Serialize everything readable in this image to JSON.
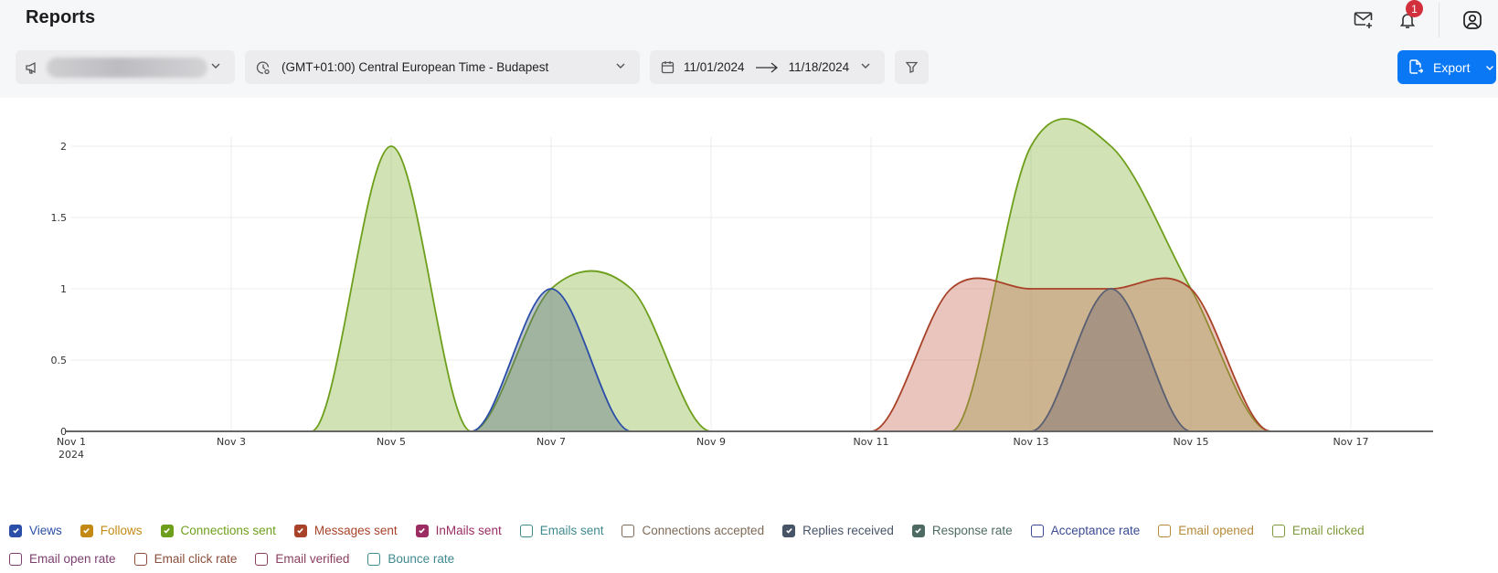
{
  "header": {
    "title": "Reports",
    "notifications_count": "1"
  },
  "filters": {
    "campaign_value": "",
    "timezone": "(GMT+01:00) Central European Time - Budapest",
    "date_from": "11/01/2024",
    "date_to": "11/18/2024"
  },
  "toolbar": {
    "export_label": "Export"
  },
  "colors": {
    "export": "#0a78f5",
    "badge": "#d2303d"
  },
  "legend": [
    {
      "label": "Views",
      "checked": true,
      "color": "#2b4ea8"
    },
    {
      "label": "Follows",
      "checked": true,
      "color": "#c28a14"
    },
    {
      "label": "Connections sent",
      "checked": true,
      "color": "#6e9f1c"
    },
    {
      "label": "Messages sent",
      "checked": true,
      "color": "#a8432a"
    },
    {
      "label": "InMails sent",
      "checked": true,
      "color": "#9b2d63"
    },
    {
      "label": "Emails sent",
      "checked": false,
      "color": "#3f8a8f"
    },
    {
      "label": "Connections accepted",
      "checked": false,
      "color": "#7d6a57"
    },
    {
      "label": "Replies received",
      "checked": true,
      "color": "#475467"
    },
    {
      "label": "Response rate",
      "checked": true,
      "color": "#4e6b63"
    },
    {
      "label": "Acceptance rate",
      "checked": false,
      "color": "#3a4a93"
    },
    {
      "label": "Email opened",
      "checked": false,
      "color": "#b58a3a"
    },
    {
      "label": "Email clicked",
      "checked": false,
      "color": "#7f9a3c"
    },
    {
      "label": "Email open rate",
      "checked": false,
      "color": "#7a3f6f"
    },
    {
      "label": "Email click rate",
      "checked": false,
      "color": "#8a4e3a"
    },
    {
      "label": "Email verified",
      "checked": false,
      "color": "#8a3f5f"
    },
    {
      "label": "Bounce rate",
      "checked": false,
      "color": "#3f8a8f"
    }
  ],
  "chart_data": {
    "type": "area",
    "title": "",
    "xlabel": "",
    "ylabel": "",
    "x": [
      "Nov 1",
      "Nov 2",
      "Nov 3",
      "Nov 4",
      "Nov 5",
      "Nov 6",
      "Nov 7",
      "Nov 8",
      "Nov 9",
      "Nov 10",
      "Nov 11",
      "Nov 12",
      "Nov 13",
      "Nov 14",
      "Nov 15",
      "Nov 16",
      "Nov 17",
      "Nov 18"
    ],
    "x_tick_labels": [
      "Nov 1\n2024",
      "Nov 3",
      "Nov 5",
      "Nov 7",
      "Nov 9",
      "Nov 11",
      "Nov 13",
      "Nov 15",
      "Nov 17"
    ],
    "y_ticks": [
      "0",
      "0.5",
      "1",
      "1.5",
      "2"
    ],
    "ylim": [
      0,
      2.1
    ],
    "grid": true,
    "series": [
      {
        "name": "Connections sent",
        "color": "#6e9f1c",
        "fill": "rgba(140,186,70,0.40)",
        "values": [
          0,
          0,
          0,
          0,
          2,
          0,
          1,
          1,
          0,
          0,
          0,
          0,
          2,
          2,
          1,
          0,
          0,
          0
        ]
      },
      {
        "name": "Messages sent",
        "color": "#a8432a",
        "fill": "rgba(200,110,90,0.40)",
        "values": [
          0,
          0,
          0,
          0,
          0,
          0,
          0,
          0,
          0,
          0,
          0,
          1,
          1,
          1,
          1,
          0,
          0,
          0
        ]
      },
      {
        "name": "Views",
        "color": "#2b4ea8",
        "fill": "rgba(90,110,130,0.40)",
        "values": [
          0,
          0,
          0,
          0,
          0,
          0,
          1,
          0,
          0,
          0,
          0,
          0,
          0,
          0,
          0,
          0,
          0,
          0
        ]
      },
      {
        "name": "Replies received",
        "color": "#5a5f72",
        "fill": "rgba(110,100,110,0.40)",
        "values": [
          0,
          0,
          0,
          0,
          0,
          0,
          0,
          0,
          0,
          0,
          0,
          0,
          0,
          1,
          0,
          0,
          0,
          0
        ]
      }
    ]
  }
}
